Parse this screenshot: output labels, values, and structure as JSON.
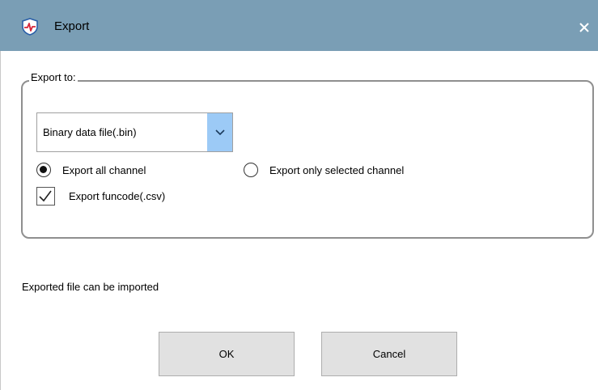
{
  "window": {
    "title": "Export",
    "app_icon": "heartbeat-shield-icon",
    "close_icon": "close-icon"
  },
  "export_group": {
    "legend": "Export to:",
    "format_select": {
      "value": "Binary data file(.bin)",
      "dropdown_icon": "chevron-down-icon"
    },
    "radio_all": {
      "label": "Export all channel",
      "checked": true
    },
    "radio_selected": {
      "label": "Export only selected channel",
      "checked": false
    },
    "checkbox_funcode": {
      "label": "Export funcode(.csv)",
      "checked": true
    }
  },
  "status_text": "Exported file can be imported",
  "buttons": {
    "ok": "OK",
    "cancel": "Cancel"
  },
  "colors": {
    "titlebar": "#7a9eb5",
    "dropdown_button": "#9ccaf6",
    "button_bg": "#e1e1e1",
    "icon_red": "#d6263a",
    "icon_blue": "#2a5fa8"
  }
}
